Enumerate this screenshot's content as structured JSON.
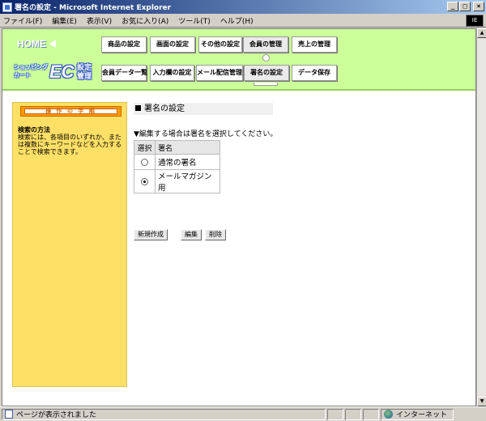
{
  "window": {
    "title": "署名の設定 - Microsoft Internet Explorer",
    "buttons": {
      "minimize": "_",
      "maximize": "□",
      "close": "×"
    }
  },
  "menubar": {
    "items": [
      "ファイル(F)",
      "編集(E)",
      "表示(V)",
      "お気に入り(A)",
      "ツール(T)",
      "ヘルプ(H)"
    ],
    "logo": "IE"
  },
  "header": {
    "home": "HOME",
    "logo": {
      "left_line1": "ショッピング",
      "left_line2": "カート",
      "center": "EC",
      "right_line1": "設定",
      "right_line2": "管理"
    },
    "nav_row1": [
      "商品の設定",
      "画面の設定",
      "その他の設定",
      "会員の管理",
      "売上の管理"
    ],
    "nav_row2": [
      "会員データ一覧",
      "入力欄の設定",
      "メール配信管理",
      "署名の設定",
      "データ保存"
    ]
  },
  "sidebar": {
    "header": "操 作 の 手 順",
    "title": "検索の方法",
    "text": "検索には、各項目のいずれか、または複数にキーワードなどを入力することで検索できます。"
  },
  "content": {
    "page_title": "署名の設定",
    "instruction": "▼編集する場合は署名を選択してください。",
    "table": {
      "headers": [
        "選択",
        "署名"
      ],
      "rows": [
        {
          "name": "通常の署名",
          "selected": false
        },
        {
          "name": "メールマガジン用",
          "selected": true
        }
      ]
    },
    "buttons": {
      "new": "新規作成",
      "edit": "編集",
      "delete": "削除"
    }
  },
  "status": {
    "text": "ページが表示されました",
    "zone": "インターネット"
  },
  "colors": {
    "header_bg": "#ccff99",
    "sidebar_bg": "#ffe066",
    "sidebar_header": "#ff9900",
    "titlebar": "#0a246a"
  }
}
